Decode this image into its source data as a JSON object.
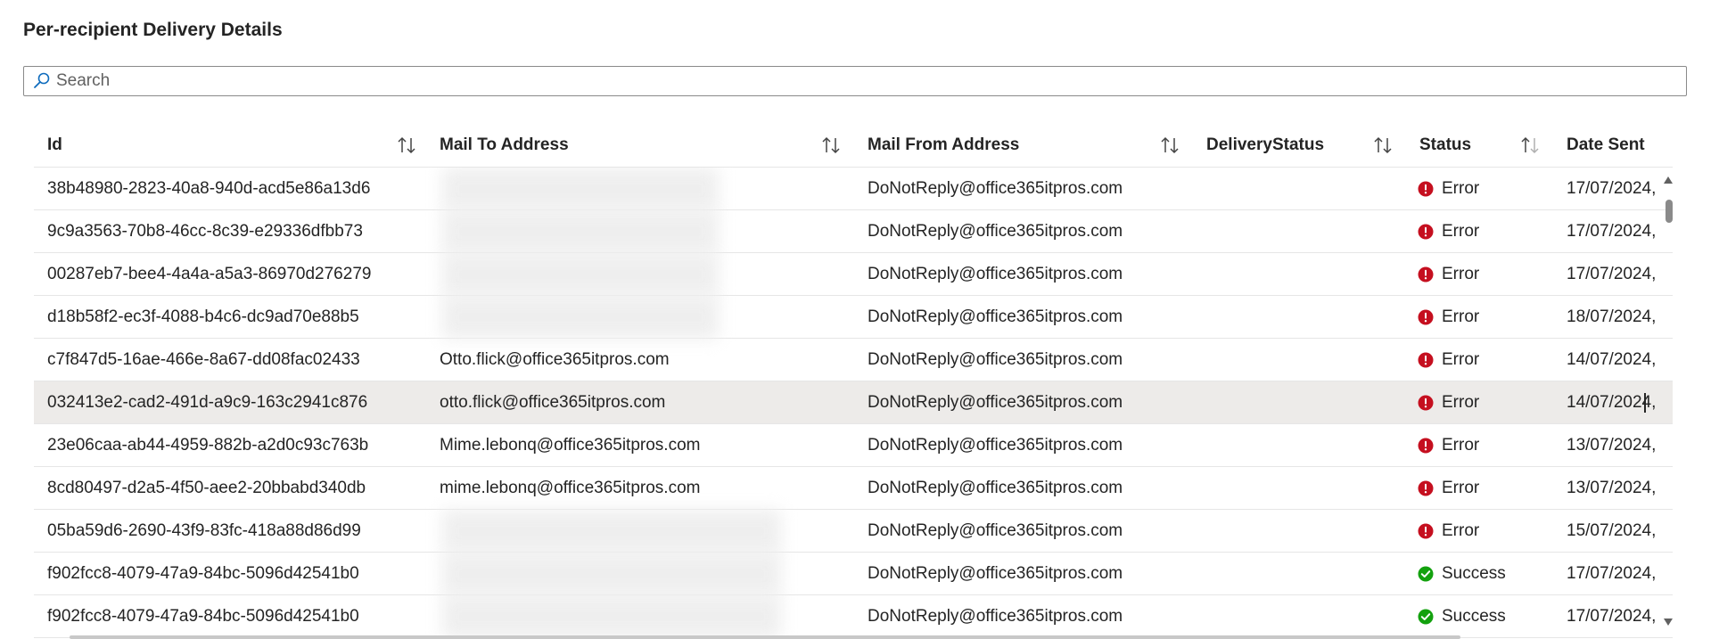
{
  "page": {
    "title": "Per-recipient Delivery Details"
  },
  "search": {
    "placeholder": "Search",
    "value": ""
  },
  "table": {
    "columns": [
      {
        "key": "id",
        "label": "Id"
      },
      {
        "key": "to",
        "label": "Mail To Address"
      },
      {
        "key": "from",
        "label": "Mail From Address"
      },
      {
        "key": "delivery",
        "label": "DeliveryStatus"
      },
      {
        "key": "status",
        "label": "Status"
      },
      {
        "key": "date",
        "label": "Date Sent"
      }
    ],
    "rows": [
      {
        "id": "38b48980-2823-40a8-940d-acd5e86a13d6",
        "to": "",
        "to_redacted": true,
        "from": "DoNotReply@office365itpros.com",
        "delivery": "",
        "status": "Error",
        "date": "17/07/2024,"
      },
      {
        "id": "9c9a3563-70b8-46cc-8c39-e29336dfbb73",
        "to": "",
        "to_redacted": true,
        "from": "DoNotReply@office365itpros.com",
        "delivery": "",
        "status": "Error",
        "date": "17/07/2024,"
      },
      {
        "id": "00287eb7-bee4-4a4a-a5a3-86970d276279",
        "to": "",
        "to_redacted": true,
        "from": "DoNotReply@office365itpros.com",
        "delivery": "",
        "status": "Error",
        "date": "17/07/2024,"
      },
      {
        "id": "d18b58f2-ec3f-4088-b4c6-dc9ad70e88b5",
        "to": "",
        "to_redacted": true,
        "from": "DoNotReply@office365itpros.com",
        "delivery": "",
        "status": "Error",
        "date": "18/07/2024,"
      },
      {
        "id": "c7f847d5-16ae-466e-8a67-dd08fac02433",
        "to": "Otto.flick@office365itpros.com",
        "to_redacted": false,
        "from": "DoNotReply@office365itpros.com",
        "delivery": "",
        "status": "Error",
        "date": "14/07/2024,"
      },
      {
        "id": "032413e2-cad2-491d-a9c9-163c2941c876",
        "to": "otto.flick@office365itpros.com",
        "to_redacted": false,
        "from": "DoNotReply@office365itpros.com",
        "delivery": "",
        "status": "Error",
        "date": "14/07/2024,",
        "selected": true
      },
      {
        "id": "23e06caa-ab44-4959-882b-a2d0c93c763b",
        "to": "Mime.lebonq@office365itpros.com",
        "to_redacted": false,
        "from": "DoNotReply@office365itpros.com",
        "delivery": "",
        "status": "Error",
        "date": "13/07/2024,"
      },
      {
        "id": "8cd80497-d2a5-4f50-aee2-20bbabd340db",
        "to": "mime.lebonq@office365itpros.com",
        "to_redacted": false,
        "from": "DoNotReply@office365itpros.com",
        "delivery": "",
        "status": "Error",
        "date": "13/07/2024,"
      },
      {
        "id": "05ba59d6-2690-43f9-83fc-418a88d86d99",
        "to": "",
        "to_redacted": true,
        "from": "DoNotReply@office365itpros.com",
        "delivery": "",
        "status": "Error",
        "date": "15/07/2024,"
      },
      {
        "id": "f902fcc8-4079-47a9-84bc-5096d42541b0",
        "to": "",
        "to_redacted": true,
        "from": "DoNotReply@office365itpros.com",
        "delivery": "",
        "status": "Success",
        "date": "17/07/2024,"
      },
      {
        "id": "f902fcc8-4079-47a9-84bc-5096d42541b0",
        "to": "",
        "to_redacted": true,
        "from": "DoNotReply@office365itpros.com",
        "delivery": "",
        "status": "Success",
        "date": "17/07/2024,"
      }
    ]
  },
  "icons": {
    "search": "search-icon",
    "sort": "sort-icon",
    "error": "error-circle-icon",
    "success": "checkmark-circle-icon"
  },
  "colors": {
    "error": "#c50f1f",
    "success": "#13a10e",
    "accent": "#0f6cbd",
    "selected_row": "#edebe9"
  }
}
